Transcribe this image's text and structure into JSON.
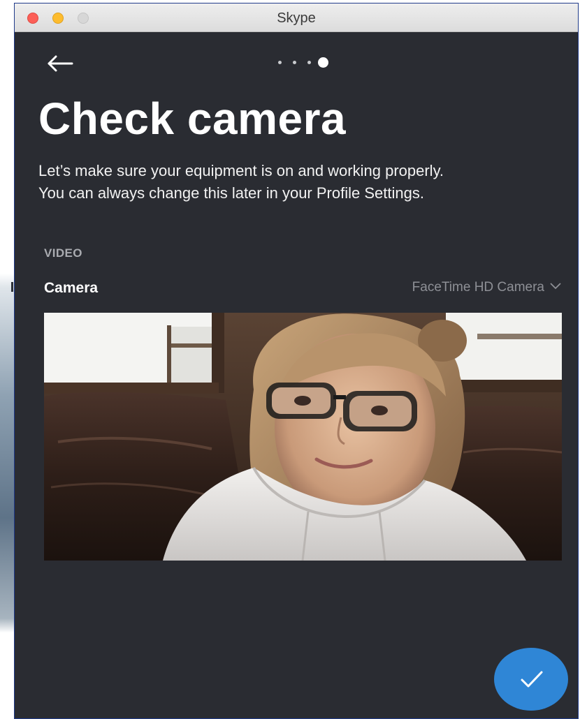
{
  "window": {
    "title": "Skype"
  },
  "navigation": {
    "back_icon": "arrow-left-icon",
    "pager": {
      "total_steps": 4,
      "current_step": 4
    }
  },
  "main": {
    "title": "Check camera",
    "subtitle_line1": "Let’s make sure your equipment is on and working properly.",
    "subtitle_line2": "You can always change this later in your Profile Settings."
  },
  "video": {
    "section_label": "VIDEO",
    "camera_label": "Camera",
    "selected_camera": "FaceTime HD Camera",
    "dropdown_icon": "chevron-down-icon"
  },
  "actions": {
    "confirm_icon": "checkmark-icon"
  },
  "colors": {
    "background": "#2a2c32",
    "accent": "#2f86d6",
    "text_primary": "#ffffff",
    "text_muted": "#8e9096"
  }
}
